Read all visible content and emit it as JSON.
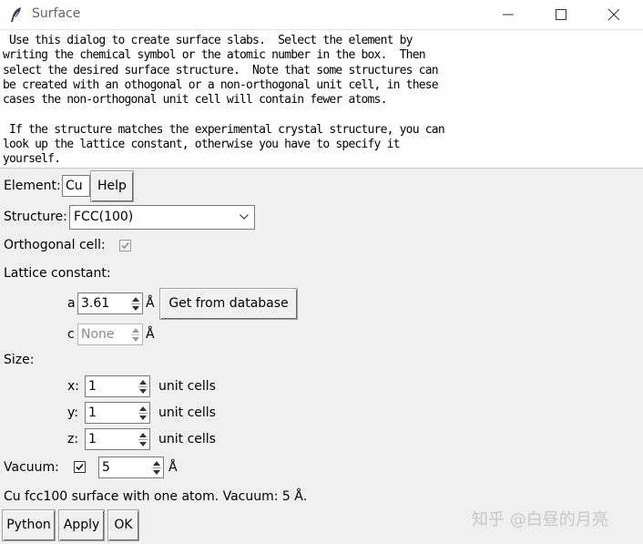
{
  "window": {
    "title": "Surface"
  },
  "description": {
    "paragraph1": " Use this dialog to create surface slabs.  Select the element by\nwriting the chemical symbol or the atomic number in the box.  Then\nselect the desired surface structure.  Note that some structures can\nbe created with an othogonal or a non-orthogonal unit cell, in these\ncases the non-orthogonal unit cell will contain fewer atoms.",
    "paragraph2": " If the structure matches the experimental crystal structure, you can\nlook up the lattice constant, otherwise you have to specify it\nyourself."
  },
  "element": {
    "label": "Element:",
    "value": "Cu",
    "help_button": "Help"
  },
  "structure": {
    "label": "Structure:",
    "selected": "FCC(100)"
  },
  "orthogonal": {
    "label": "Orthogonal cell:",
    "checked": true,
    "enabled": false
  },
  "lattice": {
    "label": "Lattice constant:",
    "a": {
      "label": "a",
      "value": "3.61",
      "unit": "Å"
    },
    "c": {
      "label": "c",
      "value": "None",
      "unit": "Å"
    },
    "database_button": "Get from database"
  },
  "size": {
    "label": "Size:",
    "x": {
      "label": "x:",
      "value": "1",
      "unit": "unit cells"
    },
    "y": {
      "label": "y:",
      "value": "1",
      "unit": "unit cells"
    },
    "z": {
      "label": "z:",
      "value": "1",
      "unit": "unit cells"
    }
  },
  "vacuum": {
    "label": "Vacuum:",
    "checked": true,
    "value": "5",
    "unit": "Å"
  },
  "status": "Cu fcc100 surface with one atom. Vacuum: 5 Å.",
  "buttons": {
    "python": "Python",
    "apply": "Apply",
    "ok": "OK"
  },
  "watermark": "知乎 @白昼的月亮",
  "icons": {
    "app": "feather-icon",
    "minimize": "minimize-icon",
    "maximize": "maximize-icon",
    "close": "close-icon"
  }
}
